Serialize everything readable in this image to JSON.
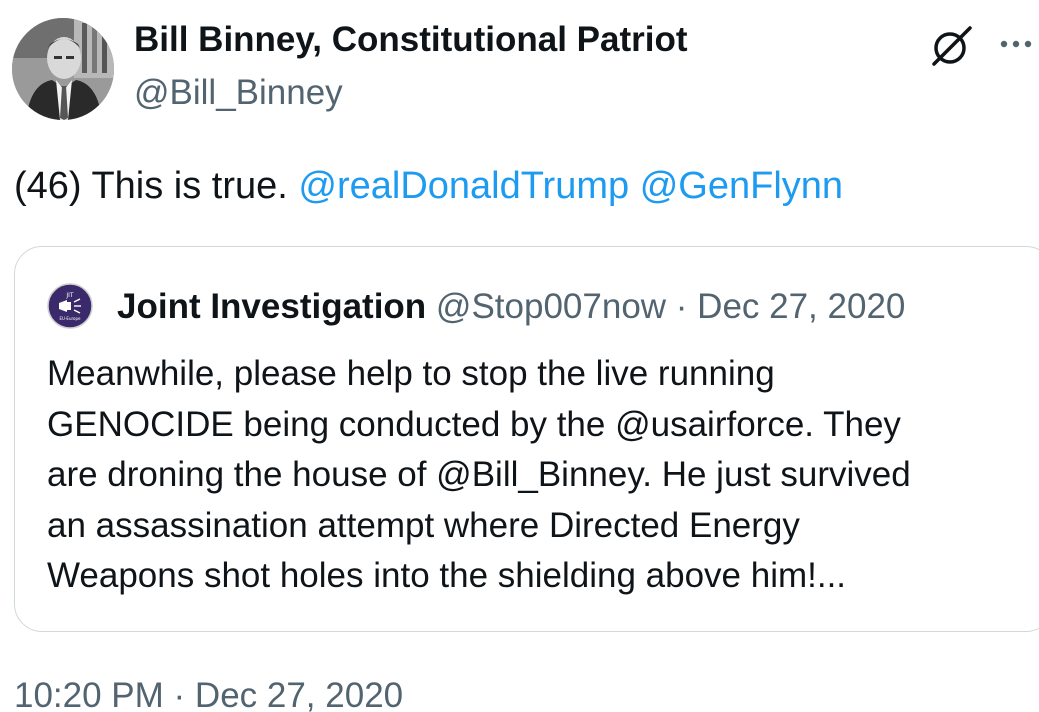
{
  "author": {
    "name": "Bill Binney, Constitutional Patriot",
    "handle": "@Bill_Binney",
    "avatar_icon": "user-avatar"
  },
  "header_actions": {
    "grok_icon": "grok-icon",
    "more_icon": "more-options-icon"
  },
  "tweet": {
    "text_prefix": "(46) This is true. ",
    "mention_1": "@realDonaldTrump",
    "space": " ",
    "mention_2": "@GenFlynn"
  },
  "quote": {
    "name": "Joint Investigation",
    "meta": " @Stop007now · Dec 27, 2020",
    "text": "Meanwhile, please help to stop the live running\nGENOCIDE being conducted by the @usairforce. They\nare droning the house of @Bill_Binney. He just survived\nan assassination attempt where Directed Energy\nWeapons shot holes into the shielding above him!...",
    "avatar_text": "JIT",
    "avatar_subtext": "EU-Europe"
  },
  "timestamp": "10:20 PM · Dec 27, 2020",
  "colors": {
    "link": "#1d9bf0",
    "secondary": "#536471",
    "border": "#cfd9de",
    "quote_avatar_bg": "#3a2a6b"
  }
}
